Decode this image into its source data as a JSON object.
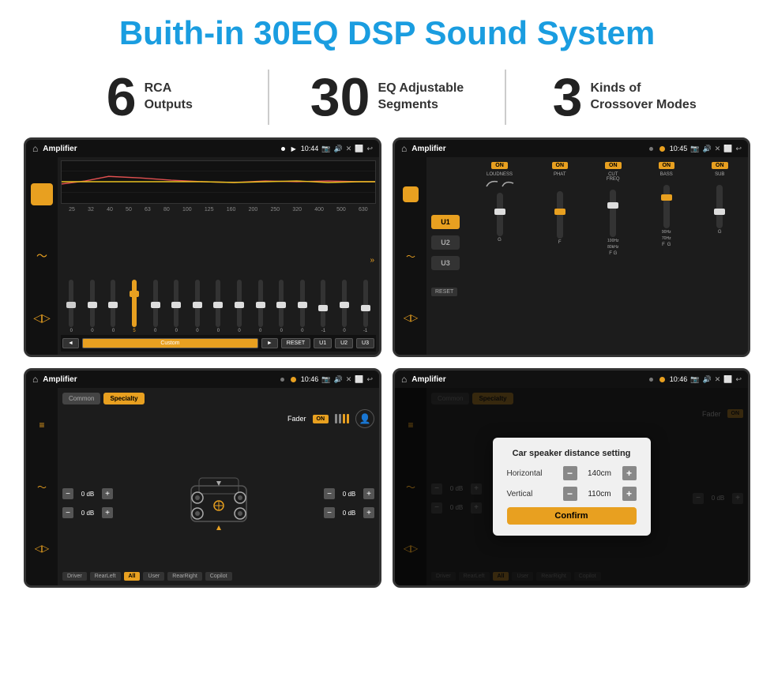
{
  "title": "Buith-in 30EQ DSP Sound System",
  "stats": [
    {
      "number": "6",
      "text": "RCA\nOutputs"
    },
    {
      "number": "30",
      "text": "EQ Adjustable\nSegments"
    },
    {
      "number": "3",
      "text": "Kinds of\nCrossover Modes"
    }
  ],
  "screens": {
    "eq": {
      "statusTitle": "Amplifier",
      "time": "10:44",
      "frequencies": [
        "25",
        "32",
        "40",
        "50",
        "63",
        "80",
        "100",
        "125",
        "160",
        "200",
        "250",
        "320",
        "400",
        "500",
        "630"
      ],
      "values": [
        "0",
        "0",
        "0",
        "5",
        "0",
        "0",
        "0",
        "0",
        "0",
        "0",
        "0",
        "0",
        "-1",
        "0",
        "-1"
      ],
      "buttons": [
        "Custom",
        "RESET",
        "U1",
        "U2",
        "U3"
      ]
    },
    "crossover": {
      "statusTitle": "Amplifier",
      "time": "10:45",
      "uButtons": [
        "U1",
        "U2",
        "U3"
      ],
      "controls": [
        "LOUDNESS",
        "PHAT",
        "CUT FREQ",
        "BASS",
        "SUB"
      ],
      "resetBtn": "RESET"
    },
    "fader": {
      "statusTitle": "Amplifier",
      "time": "10:46",
      "tabs": [
        "Common",
        "Specialty"
      ],
      "faderLabel": "Fader",
      "onLabel": "ON",
      "positions": [
        "Driver",
        "RearLeft",
        "All",
        "User",
        "RearRight",
        "Copilot"
      ],
      "volumes": [
        "0 dB",
        "0 dB",
        "0 dB",
        "0 dB"
      ]
    },
    "dialog": {
      "statusTitle": "Amplifier",
      "time": "10:46",
      "tabs": [
        "Common",
        "Specialty"
      ],
      "onLabel": "ON",
      "dialogTitle": "Car speaker distance setting",
      "horizontal": {
        "label": "Horizontal",
        "value": "140cm"
      },
      "vertical": {
        "label": "Vertical",
        "value": "110cm"
      },
      "confirmBtn": "Confirm",
      "positions": [
        "Driver",
        "RearLeft",
        "All",
        "User",
        "RearRight",
        "Copilot"
      ],
      "volumes": [
        "0 dB",
        "0 dB"
      ]
    }
  }
}
